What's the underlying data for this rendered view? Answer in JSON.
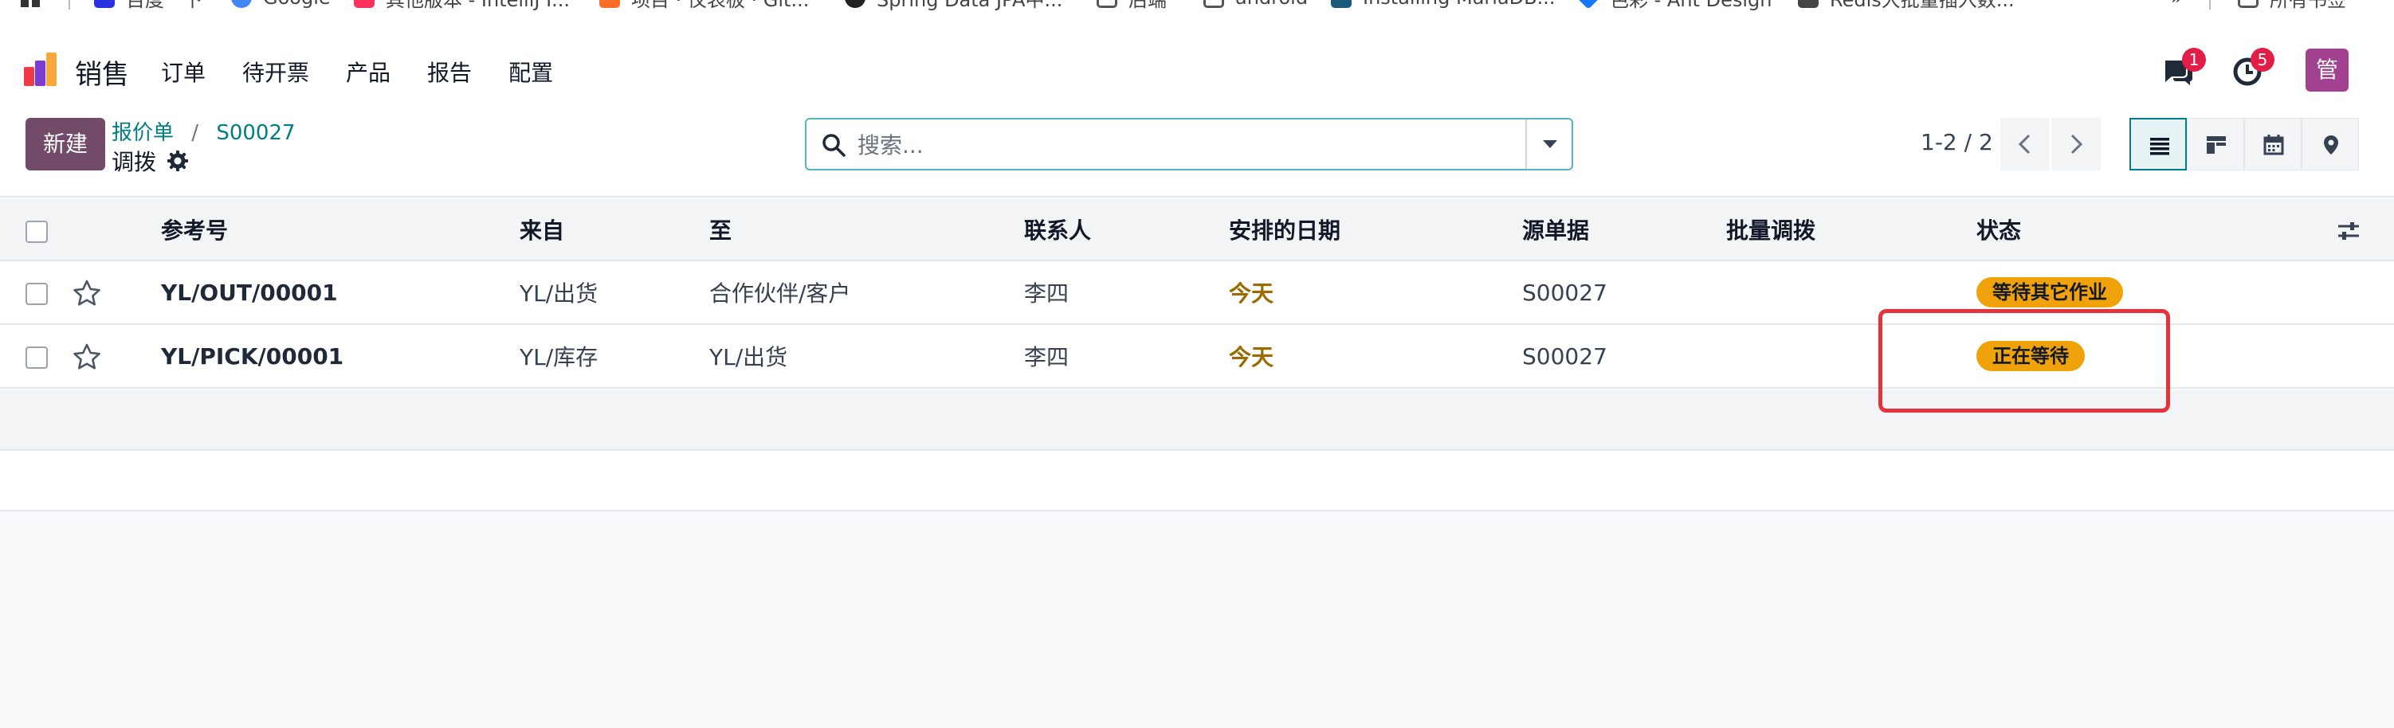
{
  "bookmarks": [
    {
      "label": "百度一下",
      "color": "#2932e1"
    },
    {
      "label": "Google",
      "color": "#4285f4"
    },
    {
      "label": "其他版本 - IntelliJ I...",
      "color": "#fe315d"
    },
    {
      "label": "项目 · 仪表板 · Git...",
      "color": "#fc6d26"
    },
    {
      "label": "Spring Data JPA中...",
      "color": "#222222"
    },
    {
      "label": "后端",
      "color": "#555555"
    },
    {
      "label": "android",
      "color": "#555555"
    },
    {
      "label": "Installing MariaDB...",
      "color": "#1a5a7a"
    },
    {
      "label": "色彩 - Ant Design",
      "color": "#1677ff"
    },
    {
      "label": "Redis大批量插入数...",
      "color": "#444444"
    }
  ],
  "bookmarks_more": "»",
  "bookmarks_all": "所有书签",
  "navbar": {
    "app_name": "销售",
    "menu": [
      "订单",
      "待开票",
      "产品",
      "报告",
      "配置"
    ],
    "messages_count": "1",
    "activities_count": "5",
    "avatar_letter": "管"
  },
  "control": {
    "new_label": "新建",
    "breadcrumb": [
      "报价单",
      "S00027"
    ],
    "breadcrumb_sep": "/",
    "subtitle": "调拨",
    "search_placeholder": "搜索...",
    "pager": "1-2 / 2"
  },
  "table": {
    "columns": [
      "参考号",
      "来自",
      "至",
      "联系人",
      "安排的日期",
      "源单据",
      "批量调拨",
      "状态"
    ],
    "rows": [
      {
        "reference": "YL/OUT/00001",
        "from": "YL/出货",
        "to": "合作伙伴/客户",
        "contact": "李四",
        "scheduled": "今天",
        "source": "S00027",
        "batch": "",
        "status": "等待其它作业"
      },
      {
        "reference": "YL/PICK/00001",
        "from": "YL/库存",
        "to": "YL/出货",
        "contact": "李四",
        "scheduled": "今天",
        "source": "S00027",
        "batch": "",
        "status": "正在等待"
      }
    ]
  },
  "colors": {
    "brand": "#714b67",
    "link": "#017e84",
    "status": "#f0a20b",
    "badge": "#e11d48",
    "highlight": "#e5333b"
  }
}
